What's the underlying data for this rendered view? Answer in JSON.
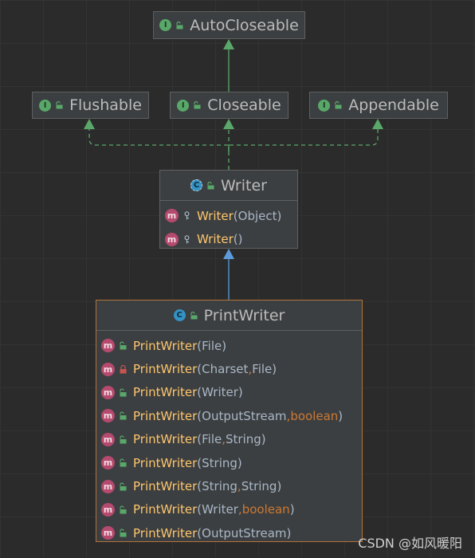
{
  "diagram": {
    "interfaces": [
      {
        "name": "AutoCloseable",
        "kind": "I"
      },
      {
        "name": "Flushable",
        "kind": "I"
      },
      {
        "name": "Closeable",
        "kind": "I"
      },
      {
        "name": "Appendable",
        "kind": "I"
      }
    ],
    "writer": {
      "name": "Writer",
      "kind": "C",
      "members": [
        {
          "name": "Writer",
          "params": [
            {
              "text": "Object",
              "kw": false
            }
          ]
        },
        {
          "name": "Writer",
          "params": []
        }
      ]
    },
    "printwriter": {
      "name": "PrintWriter",
      "kind": "C",
      "members": [
        {
          "name": "PrintWriter",
          "access": "public",
          "params": [
            {
              "text": "File",
              "kw": false
            }
          ]
        },
        {
          "name": "PrintWriter",
          "access": "private",
          "params": [
            {
              "text": "Charset",
              "kw": false
            },
            {
              "text": "File",
              "kw": false
            }
          ]
        },
        {
          "name": "PrintWriter",
          "access": "public",
          "params": [
            {
              "text": "Writer",
              "kw": false
            }
          ]
        },
        {
          "name": "PrintWriter",
          "access": "public",
          "params": [
            {
              "text": "OutputStream",
              "kw": false
            },
            {
              "text": "boolean",
              "kw": true
            }
          ]
        },
        {
          "name": "PrintWriter",
          "access": "public",
          "params": [
            {
              "text": "File",
              "kw": false
            },
            {
              "text": "String",
              "kw": false
            }
          ]
        },
        {
          "name": "PrintWriter",
          "access": "public",
          "params": [
            {
              "text": "String",
              "kw": false
            }
          ]
        },
        {
          "name": "PrintWriter",
          "access": "public",
          "params": [
            {
              "text": "String",
              "kw": false
            },
            {
              "text": "String",
              "kw": false
            }
          ]
        },
        {
          "name": "PrintWriter",
          "access": "public",
          "params": [
            {
              "text": "Writer",
              "kw": false
            },
            {
              "text": "boolean",
              "kw": true
            }
          ]
        },
        {
          "name": "PrintWriter",
          "access": "public",
          "params": [
            {
              "text": "OutputStream",
              "kw": false
            }
          ]
        }
      ]
    }
  },
  "icons": {
    "interface": "interface-icon",
    "class": "class-icon",
    "method": "method-icon",
    "public": "public-lock-icon",
    "private": "private-lock-icon",
    "protected": "protected-key-icon"
  },
  "colors": {
    "background": "#2b2b2b",
    "box": "#3c3f41",
    "selected_border": "#b0733a",
    "implements_edge": "#59a869",
    "extends_edge": "#5c9bd9",
    "method_name": "#ffc66d",
    "keyword": "#cc7832"
  },
  "watermark": "CSDN @如风暖阳"
}
